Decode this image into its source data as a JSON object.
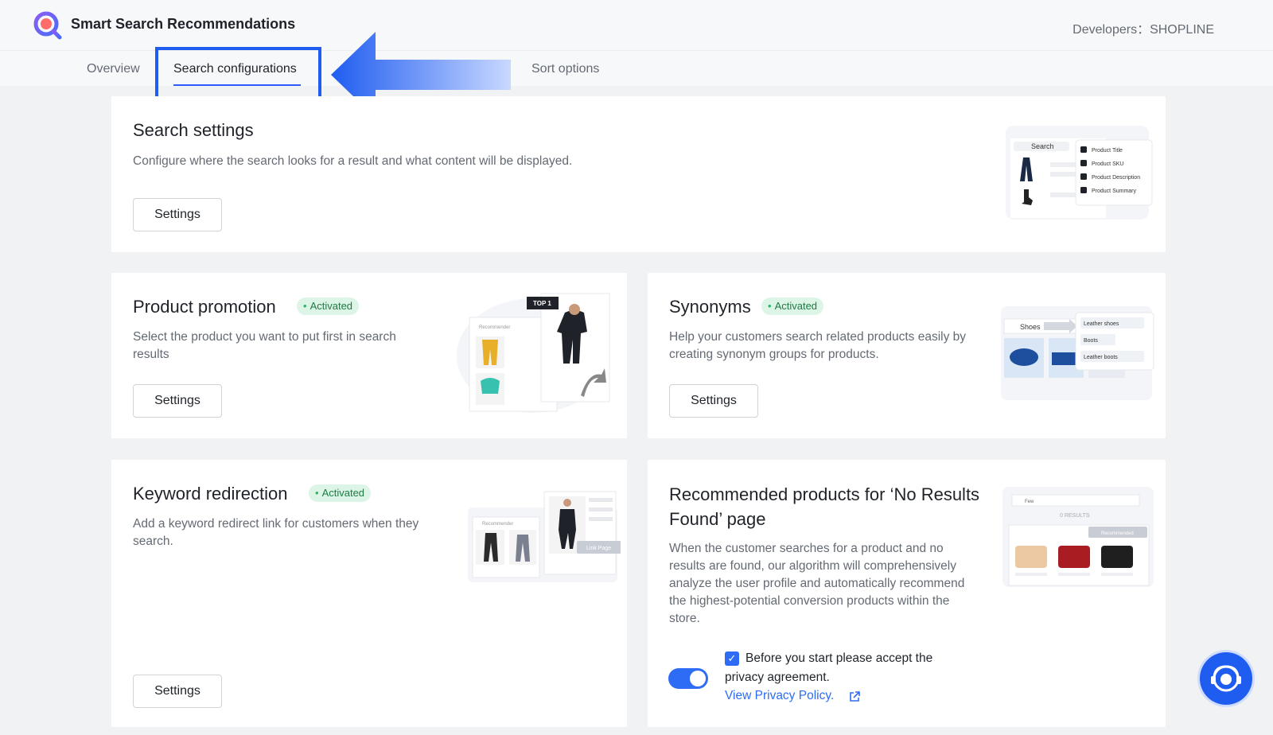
{
  "app": {
    "title": "Smart Search Recommendations",
    "developer": "Developers：SHOPLINE"
  },
  "tabs": [
    {
      "label": "Overview"
    },
    {
      "label": "Search configurations",
      "active": true
    },
    {
      "label": "Sort options"
    }
  ],
  "search_settings": {
    "title": "Search settings",
    "desc": "Configure where the search looks for a result and what content will be displayed.",
    "button": "Settings",
    "illus": {
      "search": "Search",
      "options": [
        "Product Title",
        "Product SKU",
        "Product Description",
        "Product Summary"
      ]
    }
  },
  "product_promotion": {
    "title": "Product promotion",
    "badge": "Activated",
    "desc": "Select the product you want to put first in search results",
    "button": "Settings",
    "illus": {
      "tag": "TOP 1",
      "header": "Recommender"
    }
  },
  "synonyms": {
    "title": "Synonyms",
    "badge": "Activated",
    "desc": "Help your customers search related products easily by creating synonym groups for products.",
    "button": "Settings",
    "illus": {
      "query": "Shoes",
      "chips": [
        "Leather shoes",
        "Boots",
        "Leather boots"
      ]
    }
  },
  "keyword_redirection": {
    "title": "Keyword redirection",
    "badge": "Activated",
    "desc": "Add a keyword redirect link for customers when they search.",
    "button": "Settings",
    "illus": {
      "header": "Recommender",
      "link": "Link Page"
    }
  },
  "no_results": {
    "title": "Recommended products for ‘No Results Found’ page",
    "desc": "When the customer searches for a product and no results are found, our algorithm will comprehensively analyze the user profile and automatically recommend the highest-potential conversion products within the store.",
    "agree": "Before you start please accept the privacy agreement.",
    "privacy_link": "View Privacy Policy.",
    "illus": {
      "query": "Few",
      "results": "0 RESULTS",
      "badge": "Recommended"
    }
  },
  "colors": {
    "accent": "#2e6cf6",
    "highlight": "#1f5cf0",
    "badge_bg": "#ddf5e6",
    "badge_text": "#1f7a45"
  }
}
